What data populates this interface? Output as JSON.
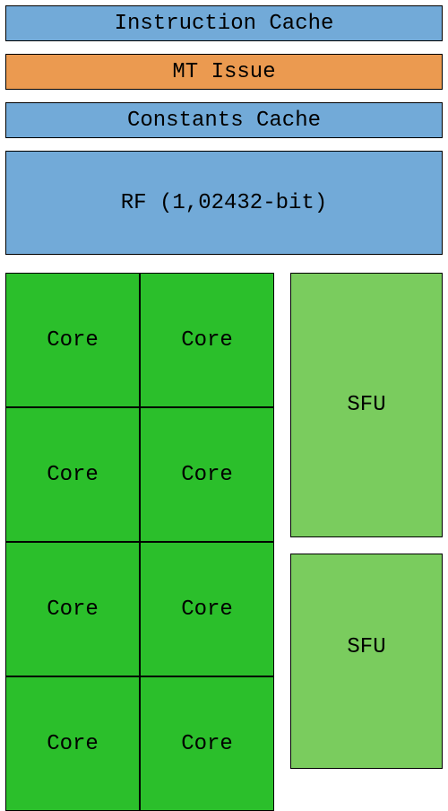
{
  "blocks": {
    "instruction_cache": "Instruction Cache",
    "mt_issue": "MT Issue",
    "constants_cache": "Constants Cache",
    "rf": "RF (1,02432-bit)"
  },
  "cores": {
    "label": "Core",
    "rows_visible": 4,
    "cols": 2
  },
  "sfu": {
    "label": "SFU",
    "count_visible": 2
  },
  "colors": {
    "blue": "#72aad8",
    "orange": "#eb9a50",
    "core_green": "#2bbf2b",
    "sfu_green": "#7acc5e"
  }
}
